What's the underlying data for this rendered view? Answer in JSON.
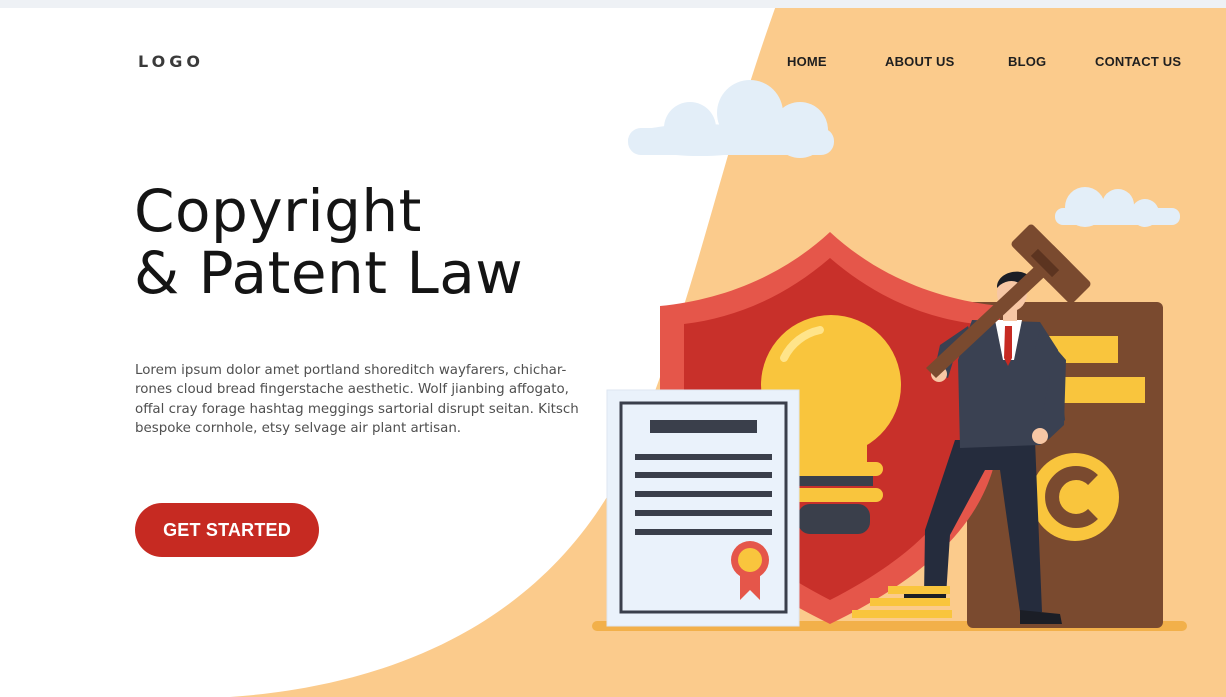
{
  "brand": {
    "logo": "LOGO"
  },
  "nav": {
    "items": [
      {
        "label": "HOME"
      },
      {
        "label": "ABOUT US"
      },
      {
        "label": "BLOG"
      },
      {
        "label": "CONTACT US"
      }
    ]
  },
  "hero": {
    "title_line1": "Copyright",
    "title_line2": "& Patent Law",
    "body_lines": [
      "Lorem ipsum dolor amet portland shoreditch wayfarers, chichar-",
      "rones cloud bread fingerstache aesthetic. Wolf jianbing affogato,",
      "offal cray forage hashtag meggings sartorial disrupt seitan. Kitsch",
      "bespoke cornhole, etsy selvage air plant artisan."
    ],
    "cta_label": "GET STARTED"
  },
  "colors": {
    "background": "#ffffff",
    "accent_peach": "#fbcb8c",
    "cta_red": "#c62a22",
    "shield_red": "#e5564a",
    "bulb_yellow": "#f9c53d",
    "book_brown": "#7a4a2f",
    "cloud": "#e3eef8"
  },
  "icons": {
    "illustration": "lawyer-with-gavel-shield-lightbulb-certificate"
  }
}
